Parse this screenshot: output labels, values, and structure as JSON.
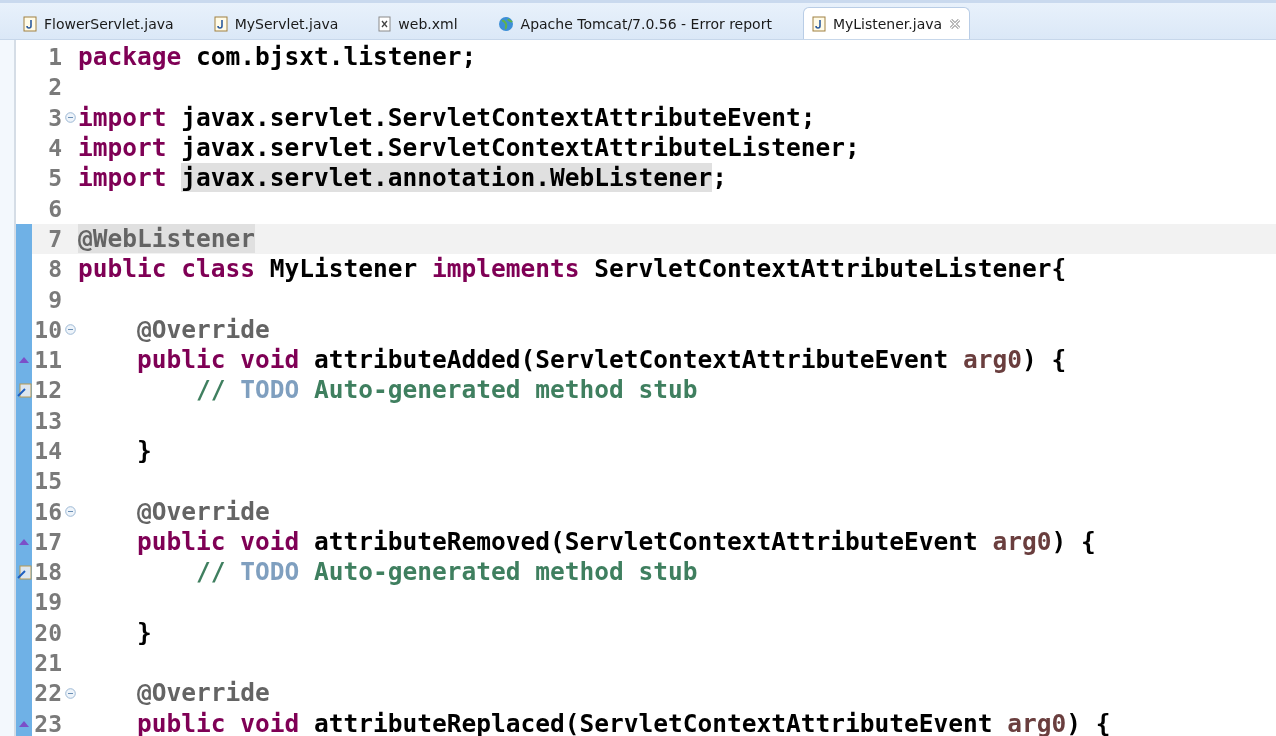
{
  "tabs": [
    {
      "label": "FlowerServlet.java",
      "kind": "java",
      "selected": false
    },
    {
      "label": "MyServlet.java",
      "kind": "java",
      "selected": false
    },
    {
      "label": "web.xml",
      "kind": "xml",
      "selected": false
    },
    {
      "label": "Apache Tomcat/7.0.56 - Error report",
      "kind": "web",
      "selected": false
    },
    {
      "label": "MyListener.java",
      "kind": "java",
      "selected": true
    }
  ],
  "lines": [
    {
      "number": "1",
      "kind": "plain",
      "in_scope": false,
      "current": false,
      "fold": false,
      "tokens": [
        {
          "kind": "keyword",
          "text": "package"
        },
        {
          "kind": "plain",
          "text": " com.bjsxt.listener;"
        }
      ]
    },
    {
      "number": "2",
      "kind": "plain",
      "in_scope": false,
      "current": false,
      "fold": false
    },
    {
      "number": "3",
      "kind": "plain",
      "in_scope": false,
      "current": false,
      "fold": true,
      "tokens": [
        {
          "kind": "keyword",
          "text": "import"
        },
        {
          "kind": "plain",
          "text": " javax.servlet.ServletContextAttributeEvent;"
        }
      ]
    },
    {
      "number": "4",
      "kind": "plain",
      "in_scope": false,
      "current": false,
      "fold": false,
      "tokens": [
        {
          "kind": "keyword",
          "text": "import"
        },
        {
          "kind": "plain",
          "text": " javax.servlet.ServletContextAttributeListener;"
        }
      ]
    },
    {
      "number": "5",
      "kind": "plain",
      "in_scope": false,
      "current": false,
      "fold": false,
      "tokens": [
        {
          "kind": "keyword",
          "text": "import "
        },
        {
          "kind": "plain",
          "text": "javax.servlet.annotation.WebListener",
          "highlighted": true
        },
        {
          "kind": "plain",
          "text": ";"
        }
      ]
    },
    {
      "number": "6",
      "kind": "plain",
      "in_scope": false,
      "current": false,
      "fold": false
    },
    {
      "number": "7",
      "kind": "plain",
      "in_scope": true,
      "current": true,
      "fold": false,
      "tokens": [
        {
          "kind": "annotation",
          "text": "@WebListener",
          "highlighted": true
        }
      ]
    },
    {
      "number": "8",
      "kind": "plain",
      "in_scope": true,
      "current": false,
      "fold": false,
      "tokens": [
        {
          "kind": "keyword",
          "text": "public class"
        },
        {
          "kind": "plain",
          "text": " MyListener "
        },
        {
          "kind": "keyword",
          "text": "implements"
        },
        {
          "kind": "plain",
          "text": " ServletContextAttributeListener{"
        }
      ]
    },
    {
      "number": "9",
      "kind": "plain",
      "in_scope": true,
      "current": false,
      "fold": false
    },
    {
      "number": "10",
      "kind": "plain",
      "in_scope": true,
      "current": false,
      "fold": true,
      "tokens": [
        {
          "kind": "annotation",
          "text": "    @Override"
        }
      ]
    },
    {
      "number": "11",
      "kind": "override",
      "in_scope": true,
      "current": false,
      "fold": false,
      "tokens": [
        {
          "kind": "keyword",
          "text": "    public void"
        },
        {
          "kind": "plain",
          "text": " attributeAdded(ServletContextAttributeEvent "
        },
        {
          "kind": "param",
          "text": "arg0"
        },
        {
          "kind": "plain",
          "text": ") {"
        }
      ]
    },
    {
      "number": "12",
      "kind": "task",
      "in_scope": true,
      "current": false,
      "fold": false,
      "tokens": [
        {
          "kind": "comment",
          "text": "        // "
        },
        {
          "kind": "todo",
          "text": "TODO"
        },
        {
          "kind": "comment",
          "text": " Auto-generated method stub"
        }
      ]
    },
    {
      "number": "13",
      "kind": "plain",
      "in_scope": true,
      "current": false,
      "fold": false
    },
    {
      "number": "14",
      "kind": "plain",
      "in_scope": true,
      "current": false,
      "fold": false,
      "tokens": [
        {
          "kind": "plain",
          "text": "    }"
        }
      ]
    },
    {
      "number": "15",
      "kind": "plain",
      "in_scope": true,
      "current": false,
      "fold": false
    },
    {
      "number": "16",
      "kind": "plain",
      "in_scope": true,
      "current": false,
      "fold": true,
      "tokens": [
        {
          "kind": "annotation",
          "text": "    @Override"
        }
      ]
    },
    {
      "number": "17",
      "kind": "override",
      "in_scope": true,
      "current": false,
      "fold": false,
      "tokens": [
        {
          "kind": "keyword",
          "text": "    public void"
        },
        {
          "kind": "plain",
          "text": " attributeRemoved(ServletContextAttributeEvent "
        },
        {
          "kind": "param",
          "text": "arg0"
        },
        {
          "kind": "plain",
          "text": ") {"
        }
      ]
    },
    {
      "number": "18",
      "kind": "task",
      "in_scope": true,
      "current": false,
      "fold": false,
      "tokens": [
        {
          "kind": "comment",
          "text": "        // "
        },
        {
          "kind": "todo",
          "text": "TODO"
        },
        {
          "kind": "comment",
          "text": " Auto-generated method stub"
        }
      ]
    },
    {
      "number": "19",
      "kind": "plain",
      "in_scope": true,
      "current": false,
      "fold": false
    },
    {
      "number": "20",
      "kind": "plain",
      "in_scope": true,
      "current": false,
      "fold": false,
      "tokens": [
        {
          "kind": "plain",
          "text": "    }"
        }
      ]
    },
    {
      "number": "21",
      "kind": "plain",
      "in_scope": true,
      "current": false,
      "fold": false
    },
    {
      "number": "22",
      "kind": "plain",
      "in_scope": true,
      "current": false,
      "fold": true,
      "tokens": [
        {
          "kind": "annotation",
          "text": "    @Override"
        }
      ]
    },
    {
      "number": "23",
      "kind": "override",
      "in_scope": true,
      "current": false,
      "fold": false,
      "tokens": [
        {
          "kind": "keyword",
          "text": "    public void"
        },
        {
          "kind": "plain",
          "text": " attributeReplaced(ServletContextAttributeEvent "
        },
        {
          "kind": "param",
          "text": "arg0"
        },
        {
          "kind": "plain",
          "text": ") {"
        }
      ]
    }
  ]
}
